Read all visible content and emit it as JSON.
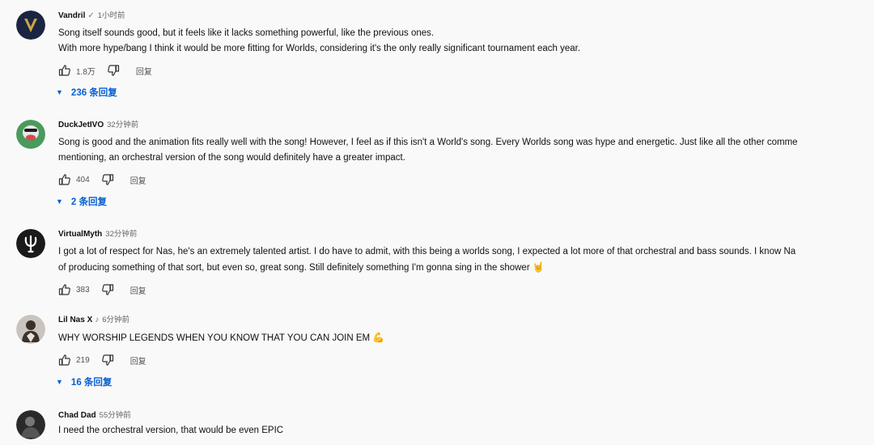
{
  "comments": [
    {
      "author": "Vandril",
      "verified": "✓",
      "time": "1小时前",
      "lines": [
        "Song itself sounds good, but it feels like it lacks something powerful, like the previous ones.",
        "With more hype/bang I think it would be more fitting for Worlds, considering it's the only really significant tournament each year."
      ],
      "likes": "1.8万",
      "reply_label": "回复",
      "replies": "236 条回复",
      "avatar_icon": "gold-v-logo-avatar",
      "avatar_colors": {
        "bg": "#1b2440",
        "fg": "#c9a44a"
      }
    },
    {
      "author": "DuckJetIVO",
      "time": "32分钟前",
      "lines": [
        "Song is good and the animation fits really well with the song! However, I feel as if this isn't a World's song. Every Worlds song was hype and energetic. Just like all the other comme",
        "mentioning, an orchestral version of the song would definitely have a greater impact."
      ],
      "likes": "404",
      "reply_label": "回复",
      "replies": "2 条回复",
      "avatar_icon": "duck-avatar",
      "avatar_colors": {
        "bg": "#4a9a5c",
        "fg": "#d9484a"
      }
    },
    {
      "author": "VirtualMyth",
      "time": "32分钟前",
      "lines": [
        "I got a lot of respect for Nas, he's an extremely talented artist. I do have to admit, with this being a worlds song, I expected a lot more of that orchestral and bass sounds. I know Na",
        "of producing something of that sort, but even so, great song. Still definitely something I'm gonna sing in the shower"
      ],
      "emoji": "🤘",
      "likes": "383",
      "reply_label": "回复",
      "avatar_icon": "trident-avatar",
      "avatar_colors": {
        "bg": "#1a1a1a",
        "fg": "#ffffff"
      }
    },
    {
      "author": "Lil Nas X",
      "note": "♪",
      "time": "6分钟前",
      "lines": [
        "WHY WORSHIP LEGENDS WHEN YOU KNOW THAT YOU CAN JOIN EM"
      ],
      "emoji": "💪",
      "likes": "219",
      "reply_label": "回复",
      "replies": "16 条回复",
      "avatar_icon": "person-photo-avatar",
      "avatar_colors": {
        "bg": "#c9c4bd",
        "fg": "#3b302a"
      }
    },
    {
      "author": "Chad Dad",
      "time": "55分钟前",
      "lines": [
        "I need the orchestral version, that would be even EPIC"
      ],
      "avatar_icon": "dark-photo-avatar",
      "avatar_colors": {
        "bg": "#2a2a2a",
        "fg": "#777777"
      }
    }
  ],
  "icons": {
    "like": "thumbs-up-icon",
    "dislike": "thumbs-down-icon",
    "expand": "caret-down-icon"
  },
  "colors": {
    "link_blue": "#065fd4",
    "background": "#f9f9f9"
  }
}
